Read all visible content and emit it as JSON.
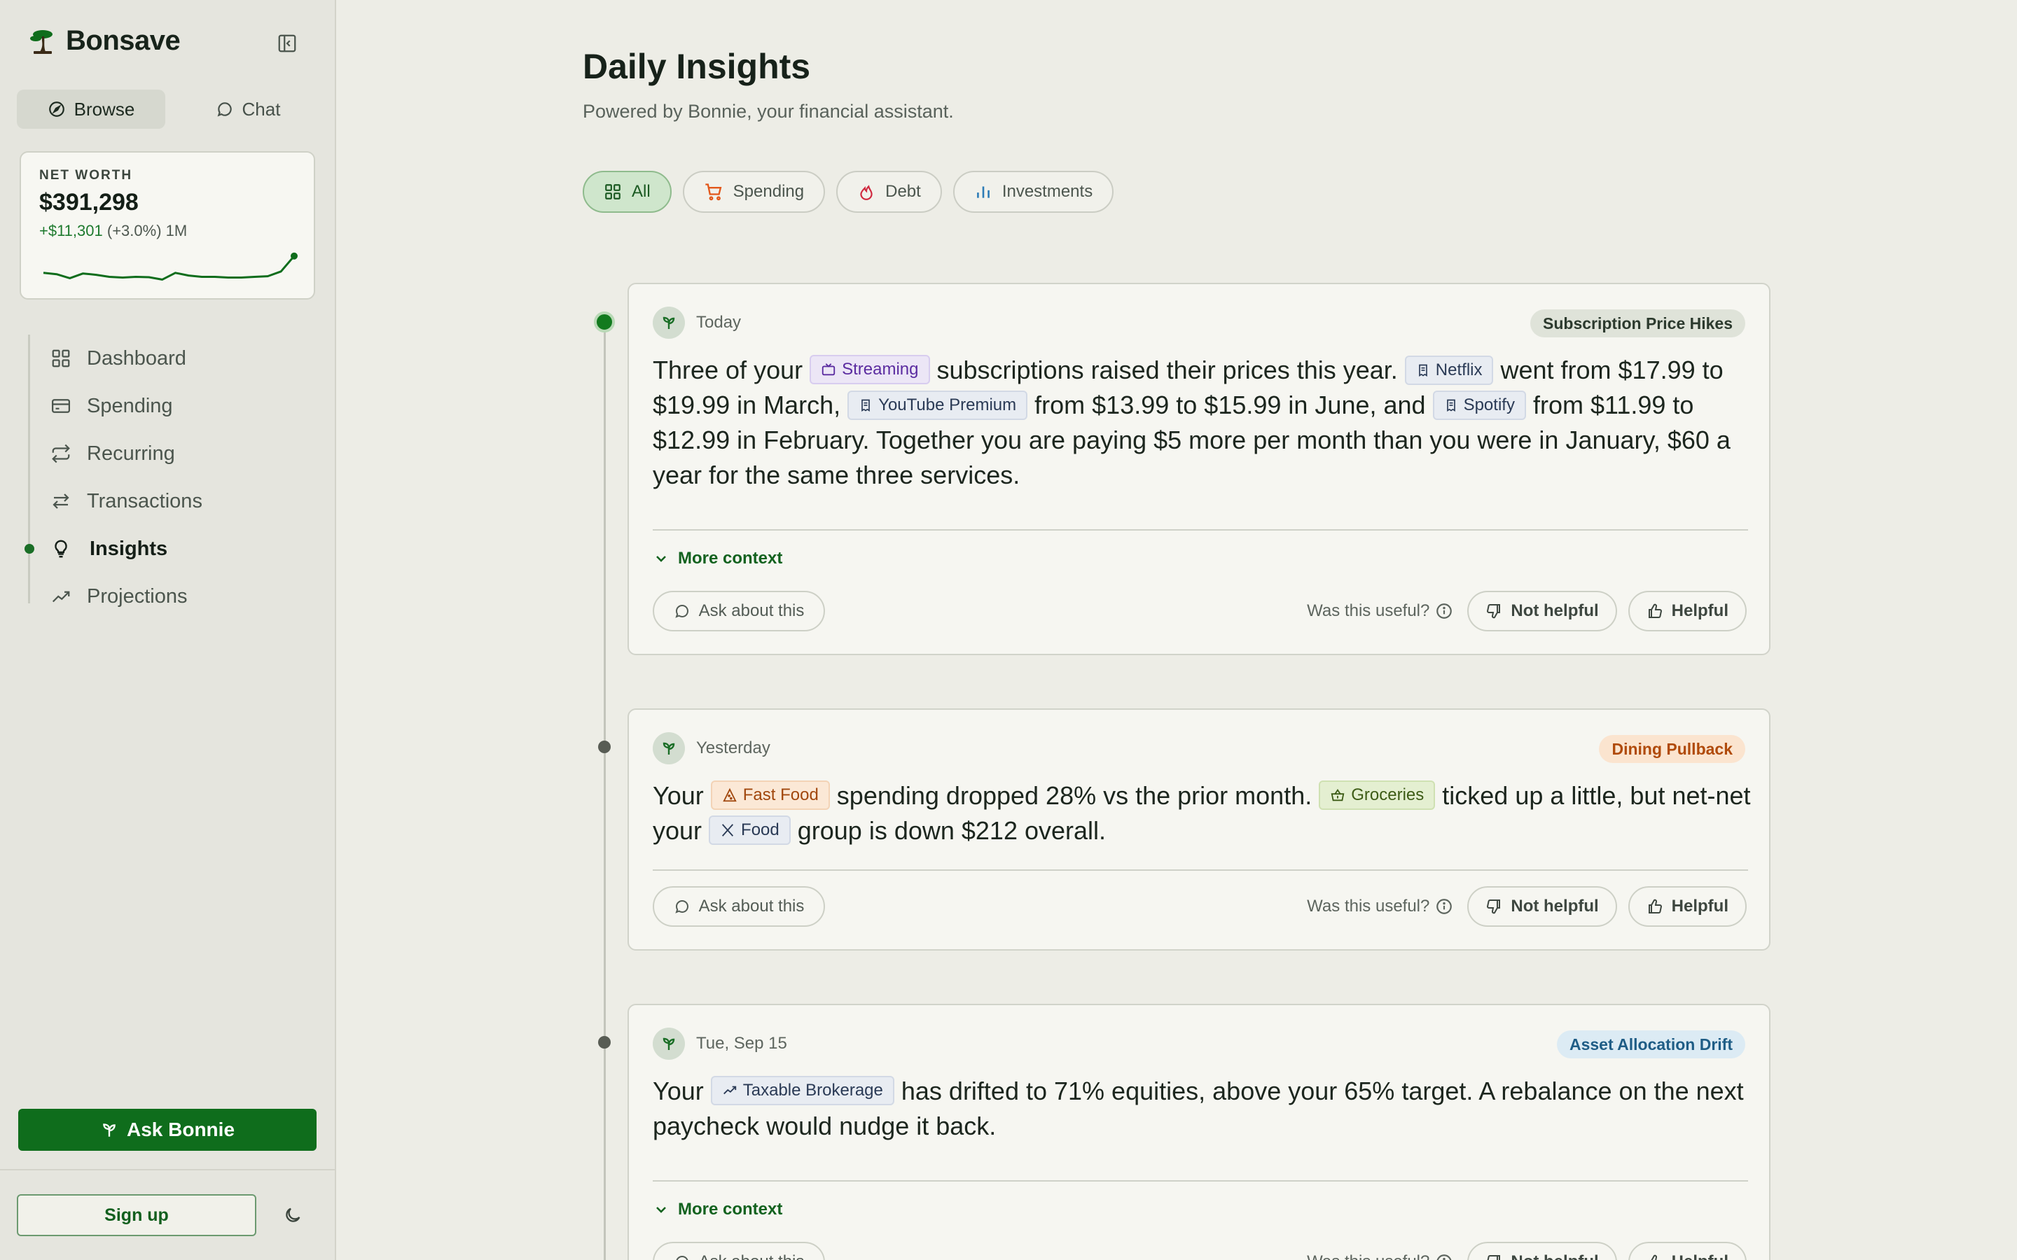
{
  "app": {
    "name": "Bonsave"
  },
  "mode_tabs": [
    {
      "label": "Browse",
      "icon": "compass-icon",
      "active": true
    },
    {
      "label": "Chat",
      "icon": "chat-bubble-icon",
      "active": false
    }
  ],
  "net_worth": {
    "label": "NET WORTH",
    "value": "$391,298",
    "change_amount": "+$11,301",
    "change_rest": "(+3.0%) 1M",
    "sparkline": [
      0.62,
      0.66,
      0.78,
      0.64,
      0.68,
      0.74,
      0.76,
      0.74,
      0.75,
      0.82,
      0.62,
      0.7,
      0.74,
      0.74,
      0.76,
      0.76,
      0.74,
      0.72,
      0.58,
      0.12
    ]
  },
  "nav": [
    {
      "label": "Dashboard",
      "icon": "dashboard-icon",
      "active": false
    },
    {
      "label": "Spending",
      "icon": "credit-card-icon",
      "active": false
    },
    {
      "label": "Recurring",
      "icon": "repeat-icon",
      "active": false
    },
    {
      "label": "Transactions",
      "icon": "arrows-exchange-icon",
      "active": false
    },
    {
      "label": "Insights",
      "icon": "lightbulb-icon",
      "active": true
    },
    {
      "label": "Projections",
      "icon": "trending-line-icon",
      "active": false
    }
  ],
  "sidebar_footer": {
    "ask_label": "Ask Bonnie",
    "signup_label": "Sign up"
  },
  "page": {
    "title": "Daily Insights",
    "subtitle": "Powered by Bonnie, your financial assistant."
  },
  "filters": [
    {
      "label": "All",
      "icon": "grid-icon",
      "active": true
    },
    {
      "label": "Spending",
      "icon": "shopping-cart-icon",
      "active": false
    },
    {
      "label": "Debt",
      "icon": "flame-icon",
      "active": false
    },
    {
      "label": "Investments",
      "icon": "bar-chart-icon",
      "active": false
    }
  ],
  "colors": {
    "brand": "#0f6d1c",
    "spending_icon": "#e2571a",
    "debt_icon": "#d0283e",
    "investments_icon": "#2c7bb6"
  },
  "common": {
    "more_context": "More context",
    "ask_about": "Ask about this",
    "useful_q": "Was this useful?",
    "not_helpful": "Not helpful",
    "helpful": "Helpful"
  },
  "insights": [
    {
      "date": "Today",
      "tag": "Subscription Price Hikes",
      "body": [
        {
          "t": "Three of your "
        },
        {
          "tag": "Streaming"
        },
        {
          "t": " subscriptions raised their prices this year. "
        },
        {
          "tag": "Netflix"
        },
        {
          "t": " went from $17.99 to $19.99 in March, "
        },
        {
          "tag": "YouTube Premium"
        },
        {
          "t": " from $13.99 to $15.99 in June, and "
        },
        {
          "tag": "Spotify"
        },
        {
          "t": " from $11.99 to $12.99 in February. Together you are paying $5 more per month than you were in January, $60 a year for the same three services."
        }
      ]
    },
    {
      "date": "Yesterday",
      "tag": "Dining Pullback",
      "body": [
        {
          "t": "Your "
        },
        {
          "tag": "Fast Food"
        },
        {
          "t": " spending dropped 28% vs the prior month. "
        },
        {
          "tag": "Groceries"
        },
        {
          "t": " ticked up a little, but net-net your "
        },
        {
          "tag": "Food"
        },
        {
          "t": " group is down $212 overall."
        }
      ]
    },
    {
      "date": "Tue, Sep 15",
      "tag": "Asset Allocation Drift",
      "body": [
        {
          "t": "Your "
        },
        {
          "tag": "Taxable Brokerage"
        },
        {
          "t": " has drifted to 71% equities, above your 65% target. A rebalance on the next paycheck would nudge it back."
        }
      ]
    }
  ]
}
